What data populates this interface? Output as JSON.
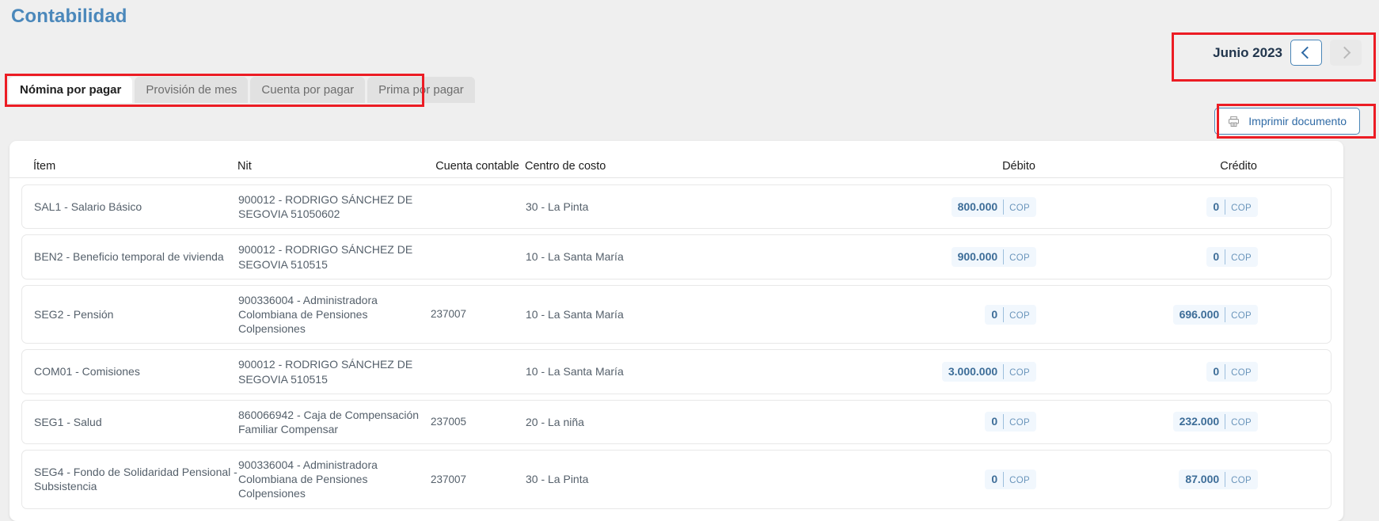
{
  "header": {
    "title": "Contabilidad"
  },
  "month_nav": {
    "label": "Junio 2023",
    "prev_icon": "chevron-left-icon",
    "next_icon": "chevron-right-icon"
  },
  "tabs": [
    {
      "label": "Nómina por pagar",
      "active": true
    },
    {
      "label": "Provisión de mes",
      "active": false
    },
    {
      "label": "Cuenta por pagar",
      "active": false
    },
    {
      "label": "Prima por pagar",
      "active": false
    }
  ],
  "actions": {
    "print_label": "Imprimir documento",
    "print_icon": "printer-icon"
  },
  "table": {
    "columns": [
      "Ítem",
      "Nit",
      "",
      "Centro de costo",
      "Débito",
      "Crédito"
    ],
    "currency": "COP",
    "rows": [
      {
        "item": "SAL1 - Salario Básico",
        "nit": "900012 - RODRIGO SÁNCHEZ DE SEGOVIA 51050602",
        "account": "",
        "cost_center": "30 - La Pinta",
        "debit": "800.000",
        "credit": "0"
      },
      {
        "item": "BEN2 - Beneficio temporal de vivienda",
        "nit": "900012 - RODRIGO SÁNCHEZ DE SEGOVIA 510515",
        "account": "",
        "cost_center": "10 - La Santa María",
        "debit": "900.000",
        "credit": "0"
      },
      {
        "item": "SEG2 - Pensión",
        "nit": "900336004 - Administradora Colombiana de Pensiones Colpensiones",
        "account": "237007",
        "cost_center": "10 - La Santa María",
        "debit": "0",
        "credit": "696.000"
      },
      {
        "item": "COM01 - Comisiones",
        "nit": "900012 - RODRIGO SÁNCHEZ DE SEGOVIA 510515",
        "account": "",
        "cost_center": "10 - La Santa María",
        "debit": "3.000.000",
        "credit": "0"
      },
      {
        "item": "SEG1 - Salud",
        "nit": "860066942 - Caja de Compensación Familiar Compensar",
        "account": "237005",
        "cost_center": "20 - La niña",
        "debit": "0",
        "credit": "232.000"
      },
      {
        "item": "SEG4 - Fondo de Solidaridad Pensional - Subsistencia",
        "nit": "900336004 - Administradora Colombiana de Pensiones Colpensiones",
        "account": "237007",
        "cost_center": "30 - La Pinta",
        "debit": "0",
        "credit": "87.000"
      }
    ]
  },
  "colors": {
    "title": "#4b88bb",
    "accent": "#2f6aa5",
    "badge_bg": "#f1f7fd",
    "annotation": "#ec1c24",
    "page_bg": "#efefef"
  }
}
